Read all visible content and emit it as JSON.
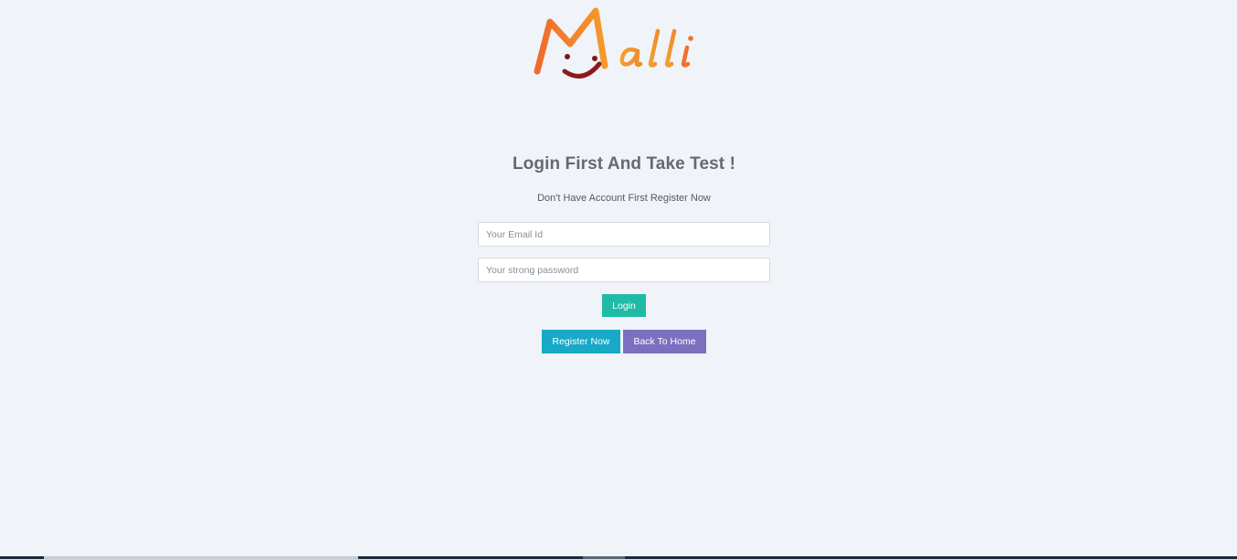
{
  "logo": {
    "text": "Malli",
    "colors": {
      "orange": "#f06a2c",
      "amber": "#f39a2a",
      "smile": "#8b1a1a"
    }
  },
  "login": {
    "title": "Login First And Take Test !",
    "subtitle": "Don't Have Account First Register Now",
    "email_placeholder": "Your Email Id",
    "password_placeholder": "Your strong password",
    "login_label": "Login",
    "register_label": "Register Now",
    "home_label": "Back To Home"
  },
  "colors": {
    "background": "#f0f3f8",
    "login_button": "#1fbba6",
    "register_button": "#17a9c7",
    "home_button": "#7c6fbf"
  }
}
